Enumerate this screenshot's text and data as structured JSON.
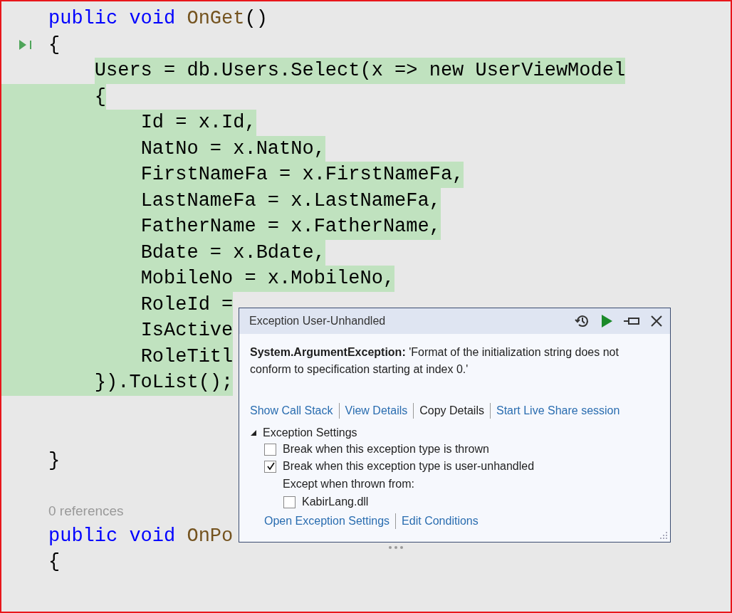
{
  "editor": {
    "lines": [
      {
        "kind": "code",
        "current": false,
        "highlighted": false,
        "tokens": [
          {
            "kind": "keyword",
            "text": "public void"
          },
          {
            "kind": "method",
            "text": " OnGet"
          },
          {
            "kind": "plain",
            "text": "()"
          }
        ]
      },
      {
        "kind": "code",
        "current": true,
        "highlighted": false,
        "tokens": [
          {
            "kind": "plain",
            "text": "{"
          }
        ]
      },
      {
        "kind": "code",
        "current": false,
        "highlighted": true,
        "tokens": [
          {
            "kind": "plain",
            "text": "    Users = db.Users.Select(x => new UserViewModel"
          }
        ]
      },
      {
        "kind": "code",
        "current": false,
        "highlighted": true,
        "tokens": [
          {
            "kind": "plain",
            "text": "    {"
          }
        ]
      },
      {
        "kind": "code",
        "current": false,
        "highlighted": true,
        "tokens": [
          {
            "kind": "plain",
            "text": "        Id = x.Id,"
          }
        ]
      },
      {
        "kind": "code",
        "current": false,
        "highlighted": true,
        "tokens": [
          {
            "kind": "plain",
            "text": "        NatNo = x.NatNo,"
          }
        ]
      },
      {
        "kind": "code",
        "current": false,
        "highlighted": true,
        "tokens": [
          {
            "kind": "plain",
            "text": "        FirstNameFa = x.FirstNameFa,"
          }
        ]
      },
      {
        "kind": "code",
        "current": false,
        "highlighted": true,
        "tokens": [
          {
            "kind": "plain",
            "text": "        LastNameFa = x.LastNameFa,"
          }
        ]
      },
      {
        "kind": "code",
        "current": false,
        "highlighted": true,
        "tokens": [
          {
            "kind": "plain",
            "text": "        FatherName = x.FatherName,"
          }
        ]
      },
      {
        "kind": "code",
        "current": false,
        "highlighted": true,
        "tokens": [
          {
            "kind": "plain",
            "text": "        Bdate = x.Bdate,"
          }
        ]
      },
      {
        "kind": "code",
        "current": false,
        "highlighted": true,
        "tokens": [
          {
            "kind": "plain",
            "text": "        MobileNo = x.MobileNo,"
          }
        ]
      },
      {
        "kind": "code",
        "current": false,
        "highlighted": true,
        "tokens": [
          {
            "kind": "plain",
            "text": "        RoleId ="
          }
        ]
      },
      {
        "kind": "code",
        "current": false,
        "highlighted": true,
        "tokens": [
          {
            "kind": "plain",
            "text": "        IsActive"
          }
        ]
      },
      {
        "kind": "code",
        "current": false,
        "highlighted": true,
        "tokens": [
          {
            "kind": "plain",
            "text": "        RoleTitl"
          }
        ]
      },
      {
        "kind": "code",
        "current": false,
        "highlighted": true,
        "tokens": [
          {
            "kind": "plain",
            "text": "    }).ToList();"
          }
        ]
      },
      {
        "kind": "blank"
      },
      {
        "kind": "blank"
      },
      {
        "kind": "code",
        "current": false,
        "highlighted": false,
        "tokens": [
          {
            "kind": "plain",
            "text": "}"
          }
        ]
      },
      {
        "kind": "blank"
      },
      {
        "kind": "codelens",
        "text": "0 references"
      },
      {
        "kind": "code",
        "current": false,
        "highlighted": false,
        "tokens": [
          {
            "kind": "keyword",
            "text": "public void"
          },
          {
            "kind": "method",
            "text": " OnPo"
          }
        ]
      },
      {
        "kind": "code",
        "current": false,
        "highlighted": false,
        "tokens": [
          {
            "kind": "plain",
            "text": "{"
          }
        ]
      }
    ]
  },
  "exception_popup": {
    "title": "Exception User-Unhandled",
    "exception_type": "System.ArgumentException:",
    "message": "'Format of the initialization string does not conform to specification starting at index 0.'",
    "actions": [
      {
        "label": "Show Call Stack",
        "kind": "link"
      },
      {
        "label": "View Details",
        "kind": "link"
      },
      {
        "label": "Copy Details",
        "kind": "plain"
      },
      {
        "label": "Start Live Share session",
        "kind": "link"
      }
    ],
    "settings": {
      "label": "Exception Settings",
      "expanded": true,
      "options": [
        {
          "label": "Break when this exception type is thrown",
          "checked": false
        },
        {
          "label": "Break when this exception type is user-unhandled",
          "checked": true
        }
      ],
      "except_label": "Except when thrown from:",
      "modules": [
        {
          "label": "KabirLang.dll",
          "checked": false
        }
      ]
    },
    "footer_links": [
      "Open Exception Settings",
      "Edit Conditions"
    ]
  }
}
